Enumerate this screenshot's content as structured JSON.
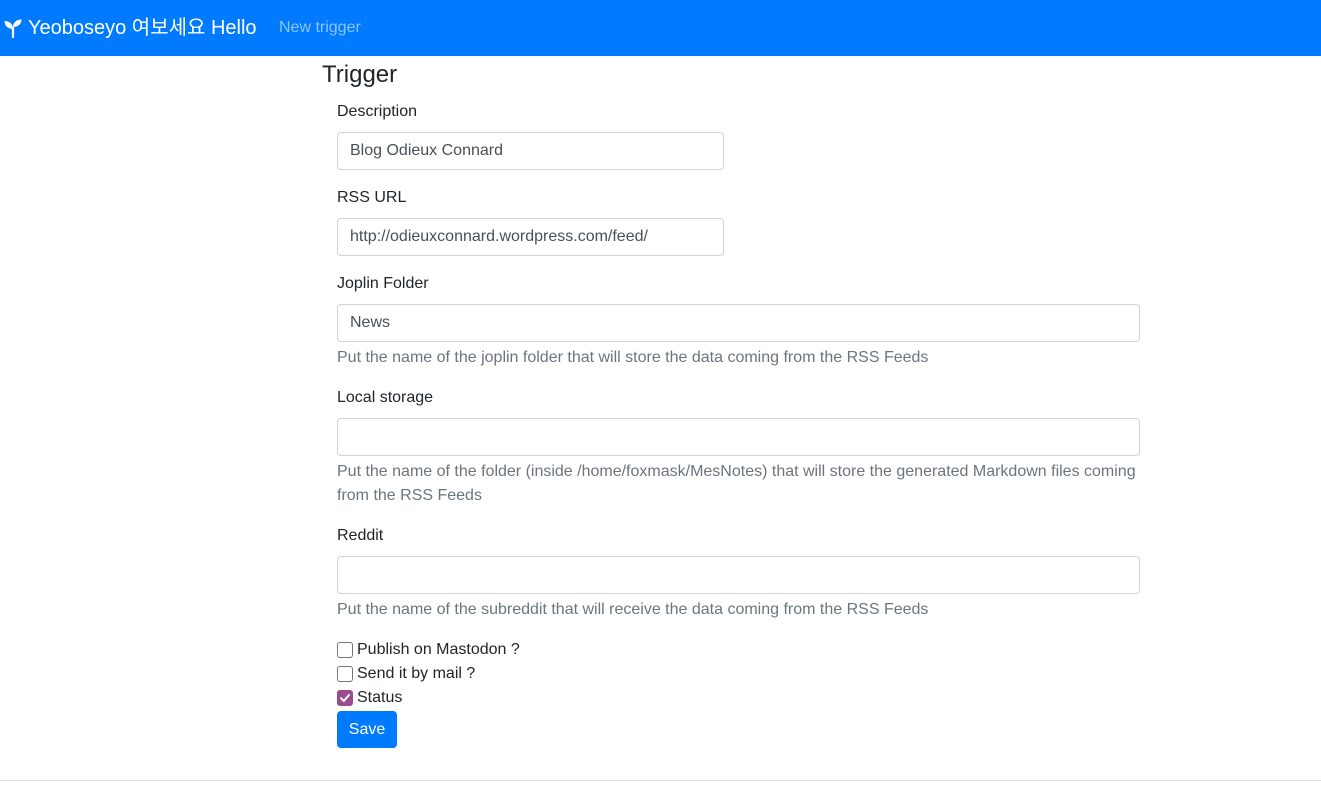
{
  "navbar": {
    "brand": "Yeoboseyo 여보세요 Hello",
    "brand_icon": "seedling-icon",
    "new_trigger": "New trigger",
    "background_color": "#007bff"
  },
  "form": {
    "title": "Trigger",
    "description": {
      "label": "Description",
      "value": "Blog Odieux Connard"
    },
    "rss_url": {
      "label": "RSS URL",
      "value": "http://odieuxconnard.wordpress.com/feed/"
    },
    "joplin_folder": {
      "label": "Joplin Folder",
      "value": "News",
      "help": "Put the name of the joplin folder that will store the data coming from the RSS Feeds"
    },
    "local_storage": {
      "label": "Local storage",
      "value": "",
      "help": "Put the name of the folder (inside /home/foxmask/MesNotes) that will store the generated Markdown files coming from the RSS Feeds"
    },
    "reddit": {
      "label": "Reddit",
      "value": "",
      "help": "Put the name of the subreddit that will receive the data coming from the RSS Feeds"
    },
    "checkboxes": [
      {
        "label": "Publish on Mastodon ?",
        "checked": false
      },
      {
        "label": "Send it by mail ?",
        "checked": false
      },
      {
        "label": "Status",
        "checked": true
      }
    ],
    "save_label": "Save",
    "checked_color": "#9a4a8e"
  }
}
